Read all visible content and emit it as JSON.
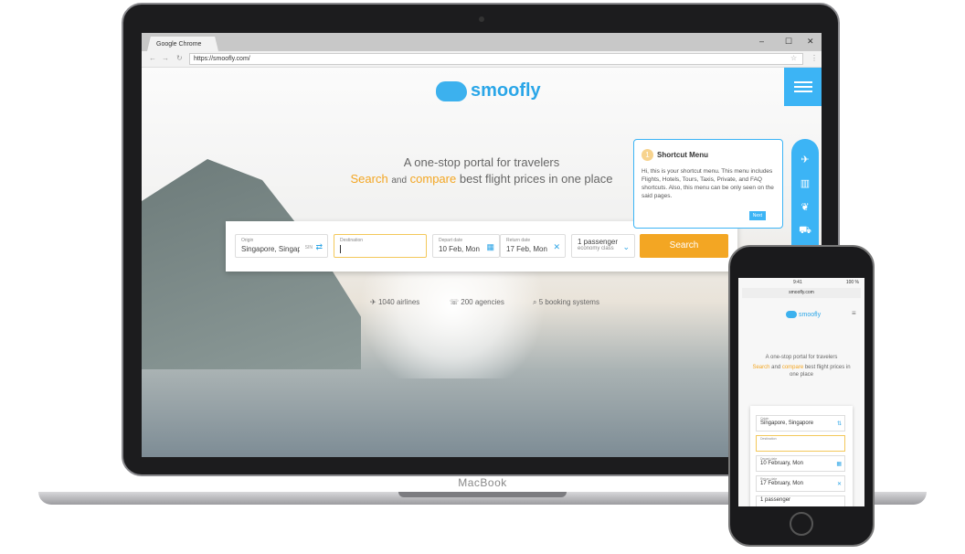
{
  "device": {
    "laptop_label": "MacBook"
  },
  "browser": {
    "tab_title": "Google Chrome",
    "url": "https://smoofly.com/",
    "controls": [
      "–",
      "☐",
      "✕"
    ]
  },
  "site": {
    "logo_text": "smoofly",
    "headline": "A one-stop portal for travelers",
    "subheadline": {
      "search": "Search",
      "and": "and",
      "compare": "compare",
      "rest": "best flight prices in one place"
    },
    "colors": {
      "accent": "#3cb4f5",
      "highlight": "#f3a623"
    },
    "form": {
      "origin": {
        "label": "Origin",
        "value": "Singapore, Singapore",
        "code": "SIN"
      },
      "destination": {
        "label": "Destination",
        "value": ""
      },
      "depart": {
        "label": "Depart date",
        "value": "10 Feb, Mon"
      },
      "return": {
        "label": "Return date",
        "value": "17 Feb, Mon"
      },
      "passengers": {
        "value": "1 passenger",
        "class": "economy class"
      },
      "search_label": "Search"
    },
    "stats": [
      "1040 airlines",
      "200 agencies",
      "5 booking systems"
    ],
    "tooltip": {
      "step": "1",
      "title": "Shortcut Menu",
      "body_html": "Hi, this is your shortcut menu. This menu includes Flights, Hotels, Tours, Taxis, Private, and FAQ shortcuts. Also, this menu can be only seen on the said pages.",
      "next_label": "Next"
    },
    "shortcut_icons": [
      "plane-icon",
      "hotel-icon",
      "leaf-icon",
      "car-icon"
    ]
  },
  "phone": {
    "time": "9:41",
    "battery": "100 %",
    "url": "smoofly.com",
    "origin_value": "Singapore, Singapore",
    "depart_value": "10 February, Mon",
    "return_value": "17 February, Mon",
    "passengers": "1 passenger"
  }
}
